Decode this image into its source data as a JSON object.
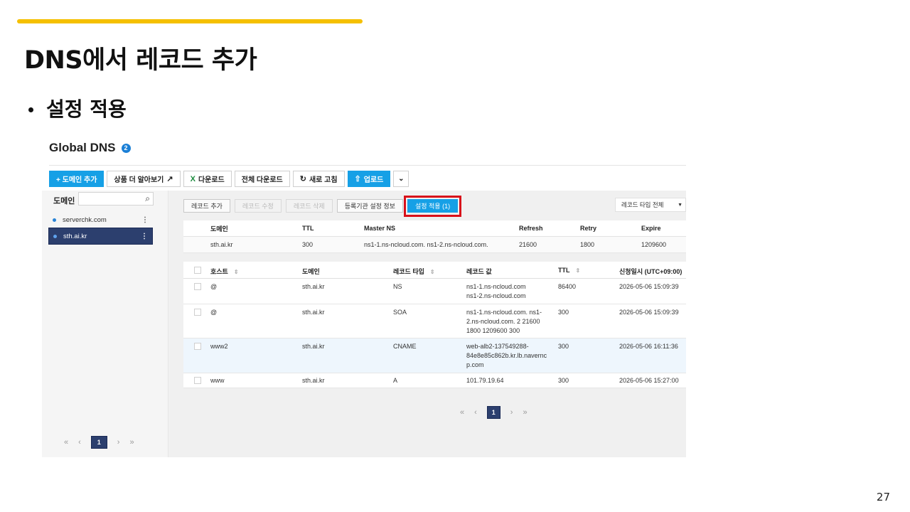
{
  "slide": {
    "title": "DNS에서 레코드 추가",
    "bullet": "설정 적용",
    "page_number": "27",
    "accent_color": "#f5c000"
  },
  "console": {
    "title": "Global DNS",
    "help_badge": "2",
    "toolbar": {
      "add_domain": "+ 도메인 추가",
      "product_info": "상품 더 알아보기",
      "download": "다운로드",
      "download_all": "전체 다운로드",
      "refresh": "새로 고침",
      "upload": "업로드"
    },
    "domain_panel": {
      "label": "도메인",
      "search_placeholder": "",
      "items": [
        {
          "name": "serverchk.com"
        },
        {
          "name": "sth.ai.kr"
        }
      ],
      "pager": {
        "current": "1"
      }
    },
    "record_toolbar": {
      "add": "레코드 추가",
      "edit": "레코드 수정",
      "delete": "레코드 삭제",
      "registrar": "등록기관 설정 정보",
      "apply": "설정 적용 (1)",
      "type_filter": "레코드 타입 전체"
    },
    "soa": {
      "headers": [
        "도메인",
        "TTL",
        "Master NS",
        "Refresh",
        "Retry",
        "Expire"
      ],
      "row": [
        "sth.ai.kr",
        "300",
        "ns1-1.ns-ncloud.com. ns1-2.ns-ncloud.com.",
        "21600",
        "1800",
        "1209600"
      ]
    },
    "records": {
      "headers": [
        "호스트",
        "도메인",
        "레코드 타입",
        "레코드 값",
        "TTL",
        "신청일시 (UTC+09:00)"
      ],
      "rows": [
        {
          "host": "@",
          "domain": "sth.ai.kr",
          "type": "NS",
          "value": "ns1-1.ns-ncloud.com\nns1-2.ns-ncloud.com",
          "ttl": "86400",
          "date": "2026-05-06 15:09:39"
        },
        {
          "host": "@",
          "domain": "sth.ai.kr",
          "type": "SOA",
          "value": "ns1-1.ns-ncloud.com. ns1-\n2.ns-ncloud.com. 2 21600\n1800 1209600 300",
          "ttl": "300",
          "date": "2026-05-06 15:09:39"
        },
        {
          "host": "www2",
          "domain": "sth.ai.kr",
          "type": "CNAME",
          "value": "web-alb2-137549288-\n84e8e85c862b.kr.lb.navernc\np.com",
          "ttl": "300",
          "date": "2026-05-06 16:11:36"
        },
        {
          "host": "www",
          "domain": "sth.ai.kr",
          "type": "A",
          "value": "101.79.19.64",
          "ttl": "300",
          "date": "2026-05-06 15:27:00"
        }
      ],
      "pager": {
        "current": "1"
      }
    }
  }
}
